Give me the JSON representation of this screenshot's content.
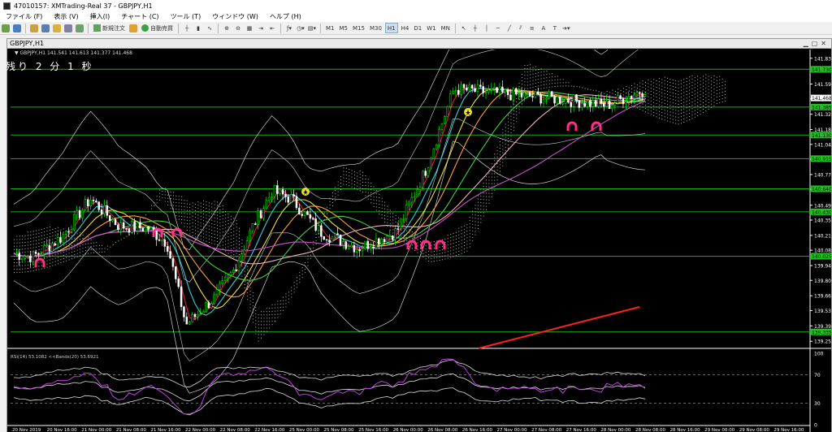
{
  "window": {
    "title": "47010157: XMTrading-Real 37 - GBPJPY,H1"
  },
  "menu": [
    "ファイル (F)",
    "表示 (V)",
    "挿入(I)",
    "チャート (C)",
    "ツール (T)",
    "ウィンドウ (W)",
    "ヘルプ (H)"
  ],
  "toolbar": {
    "new_order": "新規注文",
    "auto_trade": "自動売買",
    "timeframes": [
      "M1",
      "M5",
      "M15",
      "M30",
      "H1",
      "H4",
      "D1",
      "W1",
      "MN"
    ]
  },
  "chart": {
    "window_title": "GBPJPY,H1",
    "info_line": "▼ GBPJPY,H1  141.541 141.613 141.377 141.468",
    "countdown": "残り 2 分 1 秒",
    "price_labels": [
      "141.830",
      "141.595",
      "141.460",
      "141.320",
      "141.180",
      "141.045",
      "140.910",
      "140.770",
      "140.635",
      "140.490",
      "140.355",
      "140.215",
      "140.080",
      "139.940",
      "139.805",
      "139.665",
      "139.530",
      "139.390",
      "139.250"
    ],
    "highlighted_prices": [
      {
        "text": "141.730",
        "color": "#20c020"
      },
      {
        "text": "141.468",
        "color": "#ffffff"
      },
      {
        "text": "141.385",
        "color": "#20c020"
      },
      {
        "text": "141.130",
        "color": "#20c020"
      },
      {
        "text": "140.915",
        "color": "#20c020"
      },
      {
        "text": "140.640",
        "color": "#20c020"
      },
      {
        "text": "140.430",
        "color": "#20c020"
      },
      {
        "text": "140.025",
        "color": "#20c020"
      },
      {
        "text": "139.335",
        "color": "#20c020"
      }
    ],
    "time_labels": [
      "20 Nov 2019",
      "20 Nov 16:00",
      "21 Nov 00:00",
      "21 Nov 08:00",
      "21 Nov 16:00",
      "22 Nov 00:00",
      "22 Nov 08:00",
      "22 Nov 16:00",
      "25 Nov 00:00",
      "25 Nov 08:00",
      "25 Nov 16:00",
      "26 Nov 00:00",
      "26 Nov 08:00",
      "26 Nov 16:00",
      "27 Nov 00:00",
      "27 Nov 08:00",
      "27 Nov 16:00",
      "28 Nov 00:00",
      "28 Nov 08:00",
      "28 Nov 16:00",
      "29 Nov 00:00",
      "29 Nov 08:00",
      "29 Nov 16:00"
    ],
    "rsi_label": "RSI(14) 53.1082  <<Bands(20) 53.6921",
    "rsi_levels": [
      "100",
      "70",
      "30",
      "0"
    ]
  }
}
